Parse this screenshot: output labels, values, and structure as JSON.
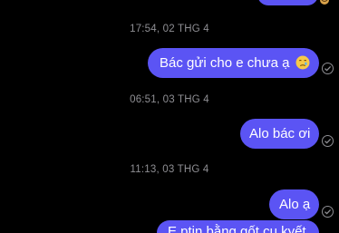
{
  "messages": [
    {
      "type": "timestamp",
      "text": "17:54, 02 THG 4"
    },
    {
      "type": "sent",
      "text": "Bác gửi cho e chưa ạ",
      "emoji": "pensive-teary-face-emoji",
      "status": "sent-check-icon"
    },
    {
      "type": "timestamp",
      "text": "06:51, 03 THG 4"
    },
    {
      "type": "sent",
      "text": "Alo bác ơi",
      "status": "sent-check-icon"
    },
    {
      "type": "timestamp",
      "text": "11:13, 03 THG 4"
    },
    {
      "type": "sent",
      "text": "Alo ạ",
      "status": "sent-check-icon"
    },
    {
      "type": "sent",
      "text": "E ptin bằng gốt cụ kyết",
      "status": "partially-visible"
    }
  ],
  "colors": {
    "background": "#000000",
    "bubble": "#5b54f4",
    "timestamp": "#8e8e93",
    "check": "#8e8e93"
  }
}
